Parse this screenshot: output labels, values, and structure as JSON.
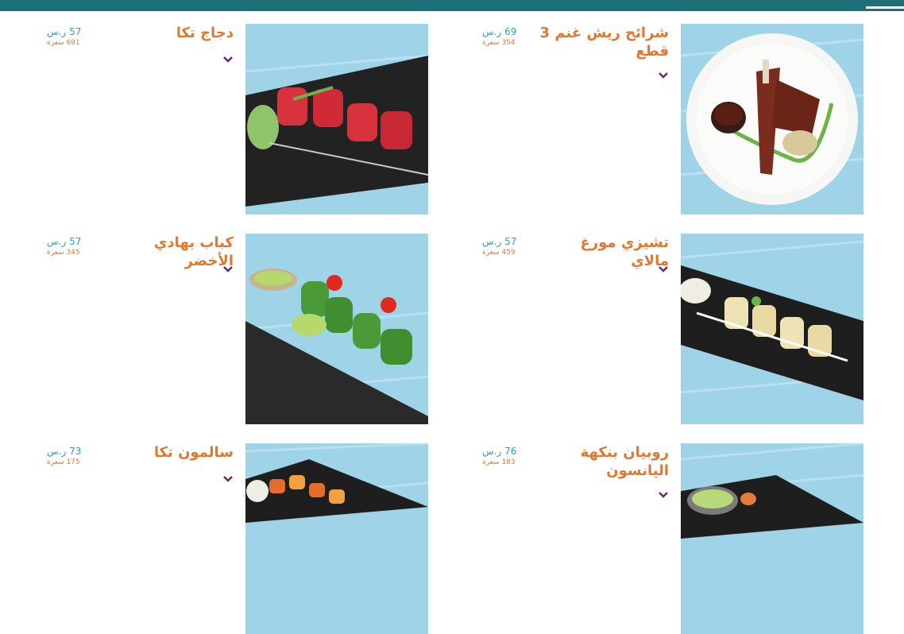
{
  "colors": {
    "topbar": "#1f6f78",
    "title": "#e0792f",
    "price": "#2aa3b6",
    "calories": "#e0792f",
    "chevron": "#6a2a6a",
    "photo_background": "#9fd3e8"
  },
  "menu": {
    "items": [
      {
        "name": "شرائح ريش غنم 3 قطع",
        "price": "69 ر.س",
        "calories": "354 سعرة",
        "image": "lamb-chops-photo"
      },
      {
        "name": "دجاج تكا",
        "price": "57 ر.س",
        "calories": "691 سعرة",
        "image": "chicken-tikka-photo"
      },
      {
        "name": "تشيزي مورغ مالاي",
        "price": "57 ر.س",
        "calories": "459 سعرة",
        "image": "murgh-malai-photo"
      },
      {
        "name": "كباب بهادي الأخضر",
        "price": "57 ر.س",
        "calories": "345 سعرة",
        "image": "green-kebab-photo"
      },
      {
        "name": "روبيان بنكهة اليانسون",
        "price": "76 ر.س",
        "calories": "183 سعرة",
        "image": "shrimp-photo"
      },
      {
        "name": "سالمون تكا",
        "price": "73 ر.س",
        "calories": "175 سعرة",
        "image": "salmon-tikka-photo"
      }
    ]
  }
}
